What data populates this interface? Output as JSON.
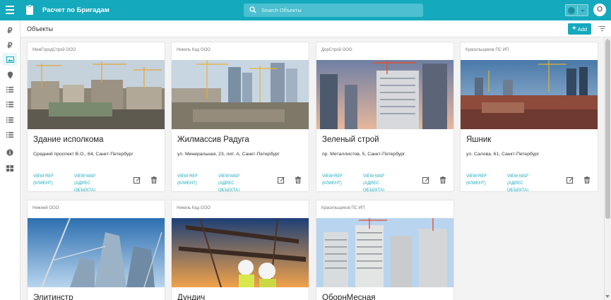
{
  "app": {
    "title": "Расчет по Бригадам",
    "search_placeholder": "Search Объекты",
    "user_initial": "O",
    "accent_color": "#14a9bd"
  },
  "sidebar": {
    "items": [
      {
        "icon": "ruble-icon",
        "label": "₽"
      },
      {
        "icon": "ruble-icon",
        "label": "₽"
      },
      {
        "icon": "image-icon"
      },
      {
        "icon": "map-pin-icon"
      },
      {
        "icon": "list-icon"
      },
      {
        "icon": "list-icon"
      },
      {
        "icon": "list-icon"
      },
      {
        "icon": "list-icon"
      },
      {
        "icon": "info-icon"
      },
      {
        "icon": "dashboard-icon"
      }
    ]
  },
  "page": {
    "title": "Объекты",
    "add_label": "Add"
  },
  "cards": [
    {
      "company": "МежГородСтрой ООО",
      "name": "Здание исполкома",
      "address": "Средний проспект В.О., 64, Санкт-Петербург",
      "link1": "VIEW REF (КЛИЕНТ)",
      "link2": "VIEW MAP (АДРЕС ОБЪЕКТА)"
    },
    {
      "company": "Никель Кад ООО",
      "name": "Жилмассив Радуга",
      "address": "ул. Минеральная, 23, лит. А, Санкт-Петербург",
      "link1": "VIEW REF (КЛИЕНТ)",
      "link2": "VIEW MAP (АДРЕС ОБЪЕКТА)"
    },
    {
      "company": "ДорСтрой ООО",
      "name": "Зеленый строй",
      "address": "пр. Металлистов, 5, Санкт-Петербург",
      "link1": "VIEW REF (КЛИЕНТ)",
      "link2": "VIEW MAP (АДРЕС ОБЪЕКТА)"
    },
    {
      "company": "Красильщиков ПС ИП",
      "name": "Яшник",
      "address": "ул. Салова, 61, Санкт-Петербург",
      "link1": "VIEW REF (КЛИЕНТ)",
      "link2": "VIEW MAP (АДРЕС ОБЪЕКТА)"
    },
    {
      "company": "Нижний ООО",
      "name": "Элитинстр",
      "address": "",
      "link1": "",
      "link2": ""
    },
    {
      "company": "Никель Кад ООО",
      "name": "Дундич",
      "address": "",
      "link1": "",
      "link2": ""
    },
    {
      "company": "Красильщиков ПС ИП",
      "name": "ОборнМесная",
      "address": "",
      "link1": "",
      "link2": ""
    }
  ]
}
